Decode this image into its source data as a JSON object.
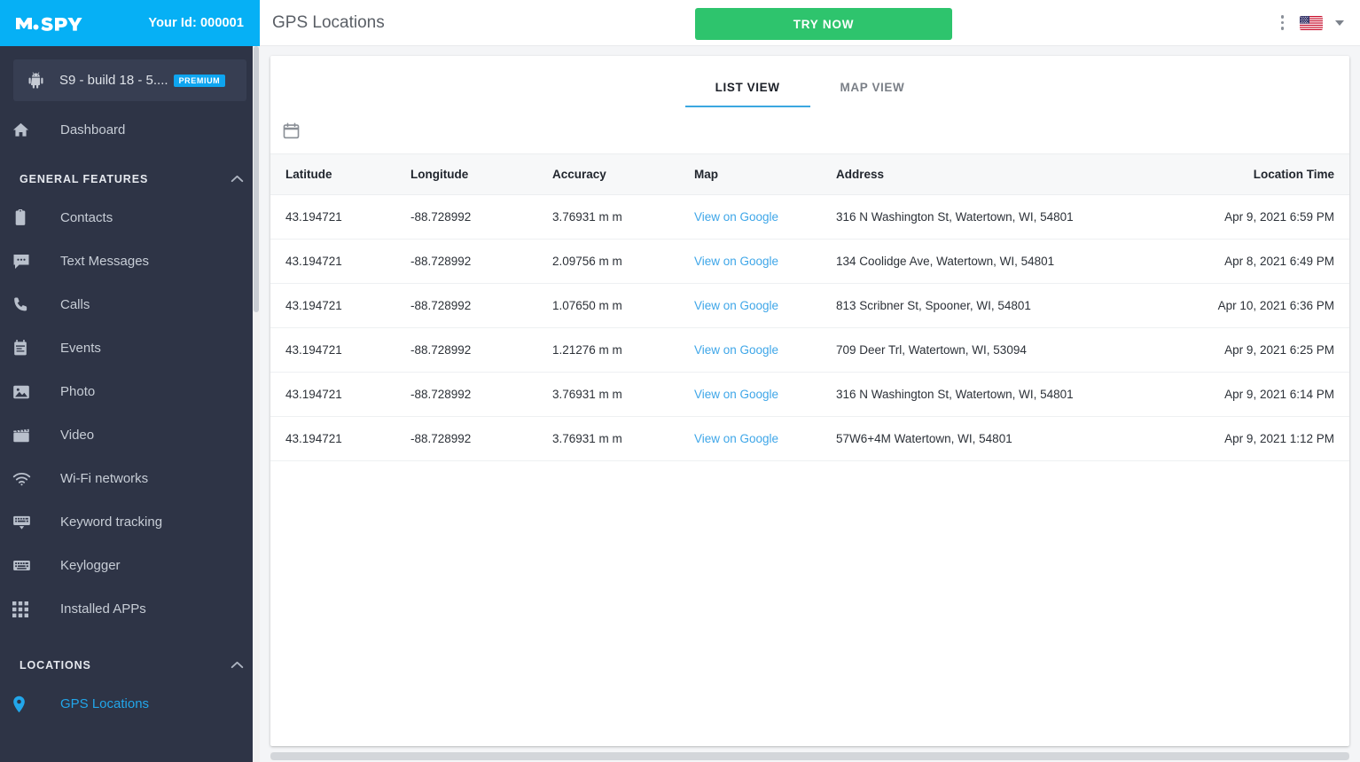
{
  "brand": {
    "logo_text": "mSPY",
    "your_id_label": "Your Id: 000001",
    "blue": "#06b0f5"
  },
  "device": {
    "name": "S9 - build 18 - 5....",
    "badge": "PREMIUM",
    "icon": "android-icon"
  },
  "sidebar": {
    "background": "#2e3446",
    "dashboard": {
      "label": "Dashboard",
      "icon": "home-icon"
    },
    "sections": [
      {
        "title": "GENERAL FEATURES",
        "collapse_icon": "chevron-up-icon",
        "items": [
          {
            "label": "Contacts",
            "icon": "contacts-icon"
          },
          {
            "label": "Text Messages",
            "icon": "message-icon"
          },
          {
            "label": "Calls",
            "icon": "phone-icon"
          },
          {
            "label": "Events",
            "icon": "calendar-icon"
          },
          {
            "label": "Photo",
            "icon": "image-icon"
          },
          {
            "label": "Video",
            "icon": "video-icon"
          },
          {
            "label": "Wi-Fi networks",
            "icon": "wifi-icon"
          },
          {
            "label": "Keyword tracking",
            "icon": "keyword-icon"
          },
          {
            "label": "Keylogger",
            "icon": "keyboard-icon"
          },
          {
            "label": "Installed APPs",
            "icon": "grid-icon"
          }
        ]
      },
      {
        "title": "LOCATIONS",
        "collapse_icon": "chevron-up-icon",
        "items": [
          {
            "label": "GPS Locations",
            "icon": "map-pin-icon",
            "active": true
          }
        ]
      }
    ],
    "active_color": "#22a6ea"
  },
  "topbar": {
    "page_title": "GPS Locations",
    "try_now_label": "TRY NOW",
    "try_now_color": "#2ec46d",
    "kebab_icon": "more-vertical-icon",
    "flag_icon": "us-flag-icon",
    "caret_icon": "chevron-down-icon"
  },
  "main": {
    "tabs": [
      {
        "label": "LIST VIEW",
        "active": true
      },
      {
        "label": "MAP VIEW",
        "active": false
      }
    ],
    "tab_underline_color": "#3ba7e0",
    "filter": {
      "calendar_icon": "calendar-icon"
    },
    "table": {
      "columns": [
        "Latitude",
        "Longitude",
        "Accuracy",
        "Map",
        "Address",
        "Location Time"
      ],
      "rows": [
        {
          "latitude": "43.194721",
          "longitude": "-88.728992",
          "accuracy": "3.76931 m m",
          "map_link": "View on Google",
          "address": "316 N Washington St, Watertown, WI, 54801",
          "location_time": "Apr 9, 2021 6:59 PM"
        },
        {
          "latitude": "43.194721",
          "longitude": "-88.728992",
          "accuracy": "2.09756 m m",
          "map_link": "View on Google",
          "address": "134 Coolidge Ave, Watertown, WI, 54801",
          "location_time": "Apr 8, 2021 6:49 PM"
        },
        {
          "latitude": "43.194721",
          "longitude": "-88.728992",
          "accuracy": "1.07650 m m",
          "map_link": "View on Google",
          "address": "813 Scribner St, Spooner, WI, 54801",
          "location_time": "Apr 10, 2021 6:36 PM"
        },
        {
          "latitude": "43.194721",
          "longitude": "-88.728992",
          "accuracy": "1.21276 m m",
          "map_link": "View on Google",
          "address": "709 Deer Trl, Watertown, WI, 53094",
          "location_time": "Apr 9, 2021 6:25 PM"
        },
        {
          "latitude": "43.194721",
          "longitude": "-88.728992",
          "accuracy": "3.76931 m m",
          "map_link": "View on Google",
          "address": "316 N Washington St, Watertown, WI, 54801",
          "location_time": "Apr 9, 2021 6:14 PM"
        },
        {
          "latitude": "43.194721",
          "longitude": "-88.728992",
          "accuracy": "3.76931 m m",
          "map_link": "View on Google",
          "address": "57W6+4M Watertown, WI, 54801",
          "location_time": "Apr 9, 2021 1:12 PM"
        }
      ],
      "link_color": "#3ea6e8"
    }
  }
}
